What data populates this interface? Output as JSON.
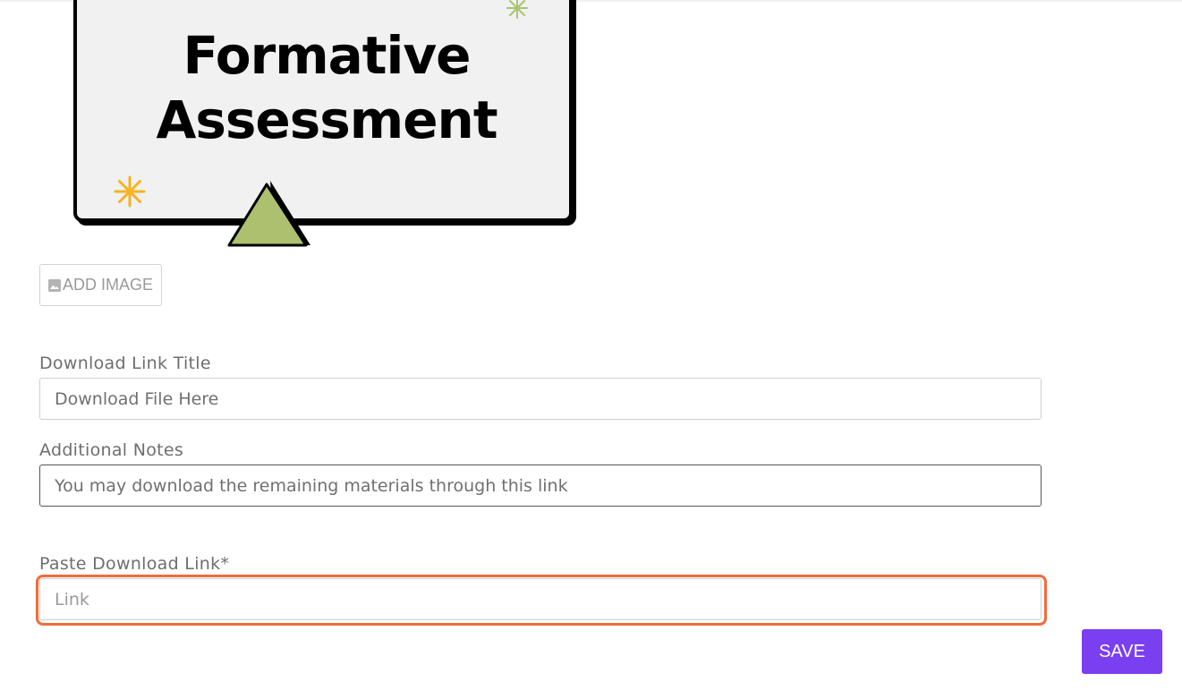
{
  "banner": {
    "title_line1": "Formative",
    "title_line2": "Assessment",
    "colors": {
      "card": "#f1f1f1",
      "triangle": "#adc070",
      "star_orange": "#f5b321",
      "star_green": "#a8c470"
    }
  },
  "add_image": {
    "label": "ADD IMAGE",
    "icon": "image-icon"
  },
  "form": {
    "download_title": {
      "label": "Download Link Title",
      "value": "Download File Here"
    },
    "notes": {
      "label": "Additional Notes",
      "value": "You may download the remaining materials through this link"
    },
    "link": {
      "label": "Paste Download Link*",
      "value": "",
      "placeholder": "Link"
    }
  },
  "save": {
    "label": "SAVE",
    "color": "#7a3ff0"
  },
  "accent": {
    "focus": "#f26b3a"
  }
}
